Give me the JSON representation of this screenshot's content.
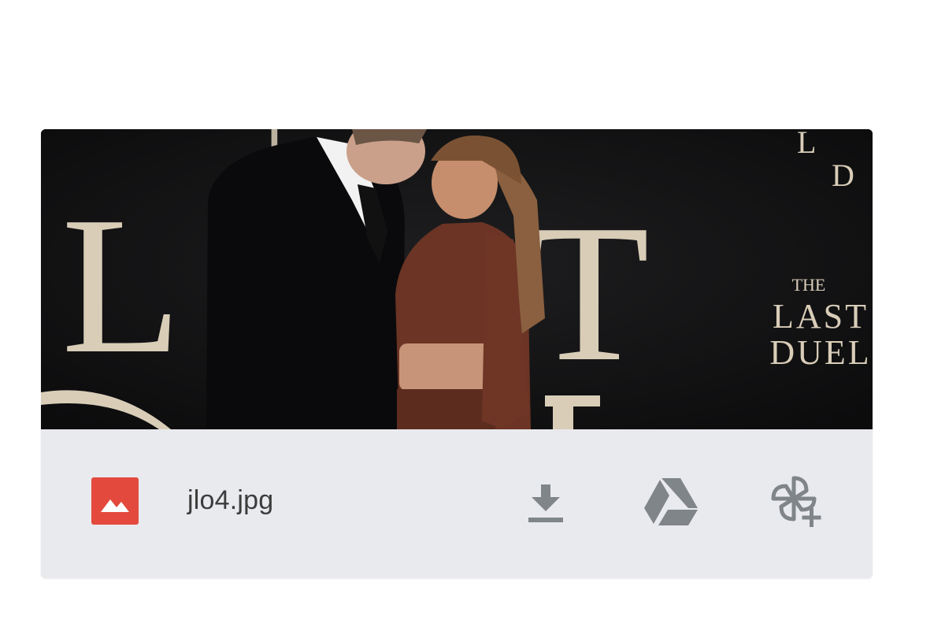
{
  "attachment": {
    "file_name": "jlo4.jpg",
    "file_type_icon": "image-file-icon",
    "file_type_color": "#e3493c",
    "preview_background_text": {
      "large_left": "L",
      "large_mid": "T",
      "poster_line1": "THE",
      "poster_line2": "LAST",
      "poster_line3": "DUEL"
    },
    "actions": [
      {
        "name": "download",
        "icon": "download-icon"
      },
      {
        "name": "save-to-drive",
        "icon": "google-drive-icon"
      },
      {
        "name": "add-to-photos",
        "icon": "google-photos-add-icon"
      }
    ],
    "colors": {
      "footer_bg": "#e9eaee",
      "icon_gray": "#808589",
      "text": "#3c3c3c"
    }
  }
}
